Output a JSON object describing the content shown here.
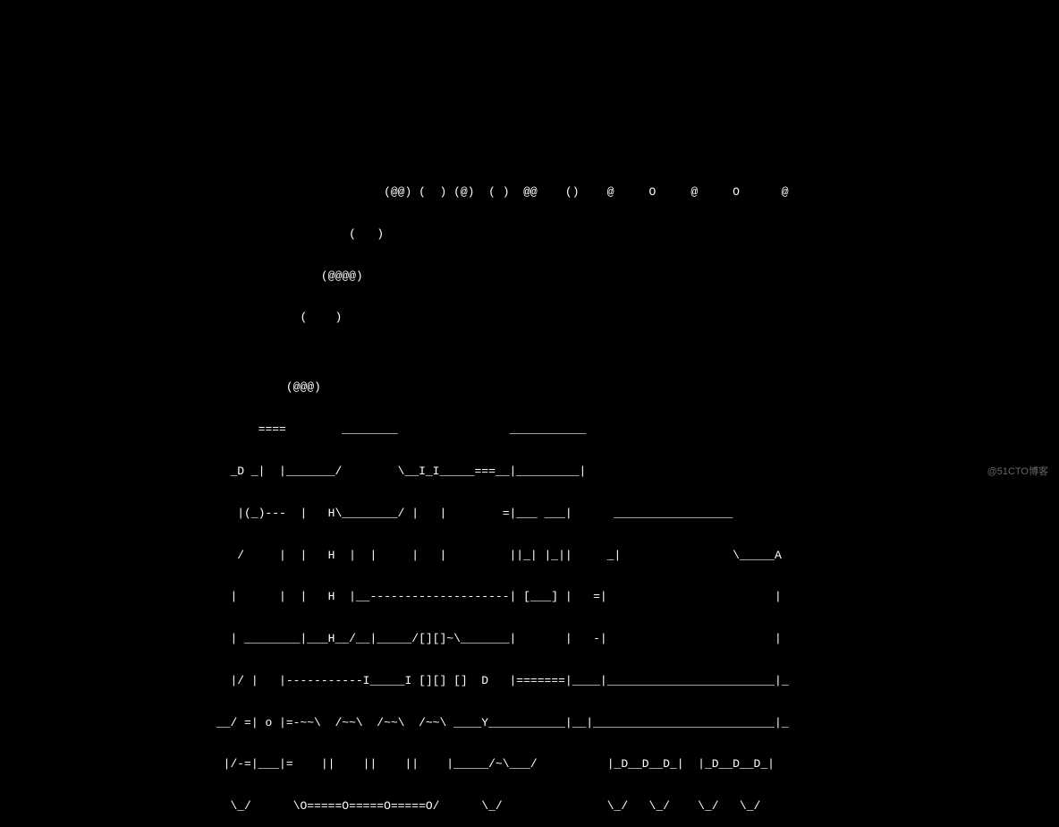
{
  "ascii_art": {
    "lines": [
      "",
      "",
      "",
      "",
      "",
      "                                                       (@@) (  ) (@)  ( )  @@    ()    @     O     @     O      @",
      "                                                  (   )",
      "                                              (@@@@)",
      "                                           (    )",
      "",
      "                                         (@@@)",
      "                                     ====        ________                ___________",
      "                                 _D _|  |_______/        \\__I_I_____===__|_________|",
      "                                  |(_)---  |   H\\________/ |   |        =|___ ___|      _________________",
      "                                  /     |  |   H  |  |     |   |         ||_| |_||     _|                \\_____A",
      "                                 |      |  |   H  |__--------------------| [___] |   =|                        |",
      "                                 | ________|___H__/__|_____/[][]~\\_______|       |   -|                        |",
      "                                 |/ |   |-----------I_____I [][] []  D   |=======|____|________________________|_",
      "                               __/ =| o |=-~~\\  /~~\\  /~~\\  /~~\\ ____Y___________|__|__________________________|_",
      "                                |/-=|___|=    ||    ||    ||    |_____/~\\___/          |_D__D__D_|  |_D__D__D_|",
      "                                 \\_/      \\O=====O=====O=====O/      \\_/               \\_/   \\_/    \\_/   \\_/"
    ]
  },
  "watermark": "@51CTO博客"
}
